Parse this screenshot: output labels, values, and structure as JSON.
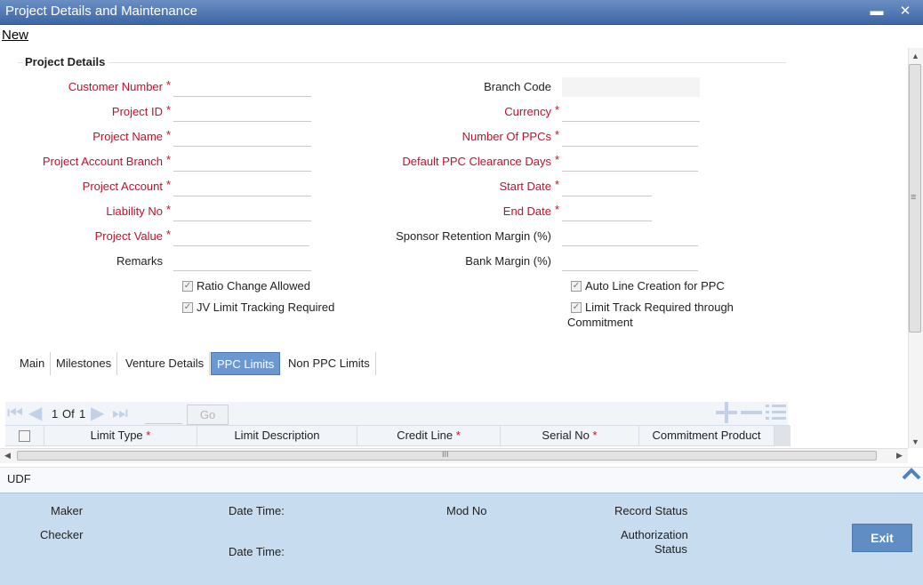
{
  "window": {
    "title": "Project Details and Maintenance",
    "minimize_glyph": "▬",
    "close_glyph": "✕"
  },
  "toolbar": {
    "new_label": "New"
  },
  "section": {
    "title": "Project Details"
  },
  "left_fields": [
    {
      "label": "Customer Number",
      "required": true
    },
    {
      "label": "Project ID",
      "required": true
    },
    {
      "label": "Project Name",
      "required": true
    },
    {
      "label": "Project Account Branch",
      "required": true
    },
    {
      "label": "Project Account",
      "required": true
    },
    {
      "label": "Liability No",
      "required": true
    },
    {
      "label": "Project Value",
      "required": true
    },
    {
      "label": "Remarks",
      "required": false
    }
  ],
  "right_fields": [
    {
      "label": "Branch Code",
      "required": false
    },
    {
      "label": "Currency",
      "required": true
    },
    {
      "label": "Number Of PPCs",
      "required": true
    },
    {
      "label": "Default PPC Clearance Days",
      "required": true
    },
    {
      "label": "Start Date",
      "required": true
    },
    {
      "label": "End Date",
      "required": true
    },
    {
      "label": "Sponsor Retention Margin (%)",
      "required": false
    },
    {
      "label": "Bank Margin (%)",
      "required": false
    }
  ],
  "required_marker": "*",
  "checkboxes": {
    "ratio_change": {
      "label": "Ratio Change Allowed",
      "checked": true
    },
    "jv_limit": {
      "label": "JV Limit Tracking Required",
      "checked": true
    },
    "auto_line": {
      "label": "Auto Line Creation for PPC",
      "checked": true
    },
    "limit_track": {
      "label": "Limit Track Required through",
      "label_line2": "Commitment",
      "checked": true
    }
  },
  "checkmark_glyph": "✓",
  "tabs": [
    "Main",
    "Milestones",
    "Venture Details",
    "PPC Limits",
    "Non PPC Limits"
  ],
  "active_tab": "PPC Limits",
  "grid": {
    "page_current": "1",
    "page_of": "Of",
    "page_total": "1",
    "go_label": "Go",
    "columns": [
      {
        "label": "Limit Type",
        "required": true
      },
      {
        "label": "Limit Description",
        "required": false
      },
      {
        "label": "Credit Line",
        "required": true
      },
      {
        "label": "Serial No",
        "required": true
      },
      {
        "label": "Commitment Product",
        "required": false
      }
    ]
  },
  "scroll": {
    "h_grip": "III",
    "v_grip": "≡"
  },
  "udf": {
    "label": "UDF"
  },
  "footer": {
    "maker": "Maker",
    "checker": "Checker",
    "date_time_1": "Date Time:",
    "date_time_2": "Date Time:",
    "mod_no": "Mod No",
    "record_status": "Record Status",
    "auth_status_line1": "Authorization",
    "auth_status_line2": "Status",
    "exit_label": "Exit"
  },
  "colors": {
    "title_bar": "#3d66a5",
    "required_label": "#c0102a",
    "active_tab": "#6c98d2",
    "footer_bg": "#c7dcee",
    "exit_button": "#5f8dc4"
  }
}
